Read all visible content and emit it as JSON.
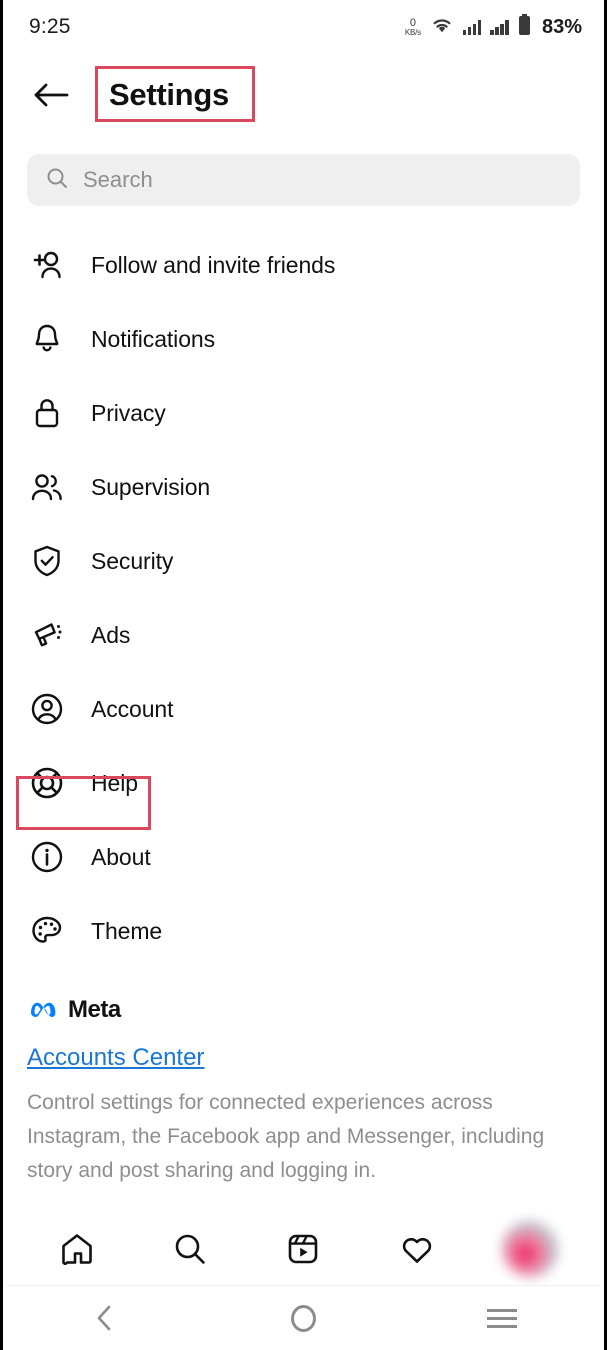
{
  "status_bar": {
    "time": "9:25",
    "network_speed_value": "0",
    "network_speed_unit": "KB/s",
    "wifi_icon": "wifi-icon",
    "signal_icon_1": "cellular-signal-icon",
    "signal_icon_2": "cellular-signal-icon",
    "battery_icon": "battery-icon",
    "battery_percent": "83%"
  },
  "header": {
    "back_icon": "back-arrow-icon",
    "title": "Settings"
  },
  "search": {
    "icon": "search-icon",
    "placeholder": "Search",
    "value": ""
  },
  "settings_list": [
    {
      "label": "Follow and invite friends",
      "icon": "person-add-icon"
    },
    {
      "label": "Notifications",
      "icon": "bell-icon"
    },
    {
      "label": "Privacy",
      "icon": "lock-icon"
    },
    {
      "label": "Supervision",
      "icon": "people-icon"
    },
    {
      "label": "Security",
      "icon": "shield-check-icon"
    },
    {
      "label": "Ads",
      "icon": "megaphone-icon"
    },
    {
      "label": "Account",
      "icon": "account-circle-icon"
    },
    {
      "label": "Help",
      "icon": "life-ring-icon"
    },
    {
      "label": "About",
      "icon": "info-circle-icon"
    },
    {
      "label": "Theme",
      "icon": "palette-icon"
    }
  ],
  "meta_section": {
    "logo_icon": "meta-infinity-icon",
    "brand": "Meta",
    "link": "Accounts Center",
    "description": "Control settings for connected experiences across Instagram, the Facebook app and Messenger, including story and post sharing and logging in."
  },
  "bottom_nav": [
    {
      "name": "home",
      "icon": "home-icon"
    },
    {
      "name": "search",
      "icon": "search-icon"
    },
    {
      "name": "reels",
      "icon": "reels-icon"
    },
    {
      "name": "activity",
      "icon": "heart-icon"
    },
    {
      "name": "profile",
      "icon": "profile-avatar"
    }
  ],
  "android_nav": [
    {
      "name": "back",
      "icon": "chevron-left-icon"
    },
    {
      "name": "home",
      "icon": "circle-icon"
    },
    {
      "name": "recents",
      "icon": "hamburger-icon"
    }
  ],
  "annotations": {
    "color": "#d9485f",
    "highlighted_title": "Settings",
    "highlighted_item": "Help"
  }
}
